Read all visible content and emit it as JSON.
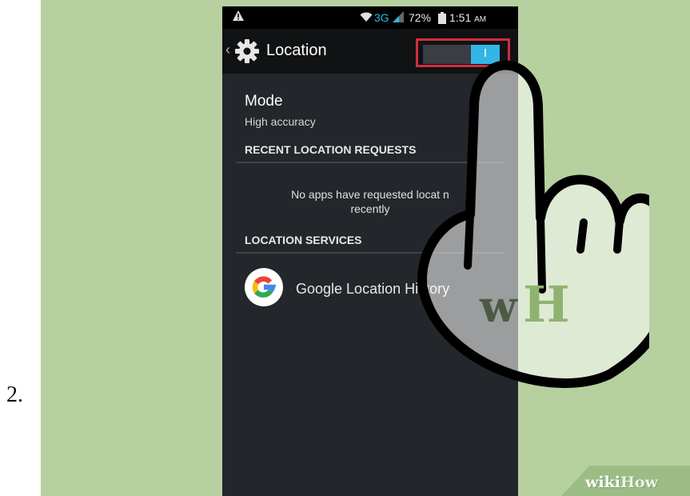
{
  "step": {
    "number": "2."
  },
  "statusbar": {
    "network": "3G",
    "battery": "72%",
    "time": "1:51",
    "ampm": "AM"
  },
  "actionbar": {
    "title": "Location",
    "toggle_label": "I",
    "toggle_state": "on"
  },
  "mode": {
    "title": "Mode",
    "value": "High accuracy"
  },
  "recent_requests": {
    "header": "RECENT LOCATION REQUESTS",
    "empty_line1": "No apps have requested locat",
    "empty_line1_tail": "n",
    "empty_line2": "recently"
  },
  "services": {
    "header": "LOCATION SERVICES",
    "items": [
      {
        "label": "Google Location History",
        "icon": "google-g-icon"
      }
    ]
  },
  "overlay": {
    "logo_text_w": "w",
    "logo_text_h": "H"
  },
  "watermark": {
    "part1": "wiki",
    "part2": "How"
  },
  "colors": {
    "background": "#b7d09f",
    "accent": "#33b5e5",
    "highlight": "#d32c3d",
    "screen": "#23262a"
  }
}
